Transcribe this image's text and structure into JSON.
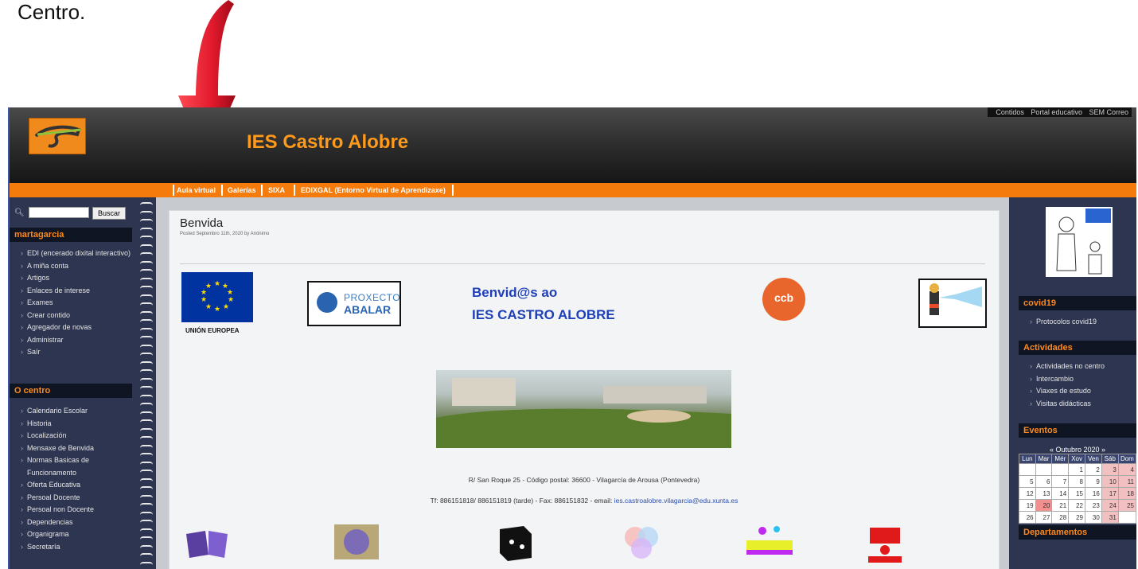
{
  "caption": "Centro.",
  "header": {
    "site_title": "IES Castro Alobre",
    "top_links": [
      "Contidos",
      "Portal educativo",
      "SEM Correo"
    ]
  },
  "nav": [
    "Aula virtual",
    "Galerías",
    "SIXA",
    "EDIXGAL (Entorno Virtual de Aprendizaxe)"
  ],
  "search": {
    "button": "Buscar",
    "value": ""
  },
  "user_block": {
    "title": "martagarcia",
    "items": [
      "EDI (encerado dixital interactivo)",
      "A miña conta",
      "Artigos",
      "Enlaces de interese",
      "Exames",
      "Crear contido",
      "Agregador de novas",
      "Administrar",
      "Saír"
    ]
  },
  "centro_block": {
    "title": "O centro",
    "items": [
      "Calendario Escolar",
      "Historia",
      "Localización",
      "Mensaxe de Benvida",
      "Normas Basicas de Funcionamento",
      "Oferta Educativa",
      "Persoal Docente",
      "Persoal non Docente",
      "Dependencias",
      "Organigrama",
      "Secretaría"
    ]
  },
  "post": {
    "title": "Benvida",
    "meta": "Posted Septembro 11th, 2020 by Anónimo",
    "eu_label": "UNIÓN EUROPEA",
    "abalar_top": "PROXECTO",
    "abalar_bottom": "ABALAR",
    "welcome_line1": "Benvid@s ao",
    "welcome_line2": "IES CASTRO ALOBRE",
    "ccb_text": "ccb",
    "address": "R/ San Roque 25 -   Código postal: 36600 - Vilagarcía de Arousa (Pontevedra)",
    "contact_prefix": "Tf: 886151818/ 886151819 (tarde) - Fax: 886151832 - email: ",
    "contact_email": "ies.castroalobre.vilagarcia@edu.xunta.es"
  },
  "right": {
    "covid_title": "covid19",
    "covid_items": [
      "Protocolos covid19"
    ],
    "actividades_title": "Actividades",
    "actividades_items": [
      "Actividades no centro",
      "Intercambio",
      "Viaxes de estudo",
      "Visitas didácticas"
    ],
    "eventos_title": "Eventos",
    "calendar_title": "« Outubro 2020 »",
    "weekdays": [
      "Lun",
      "Mar",
      "Mér",
      "Xov",
      "Ven",
      "Sáb",
      "Dom"
    ],
    "weeks": [
      [
        "",
        "",
        "",
        "1",
        "2",
        "3",
        "4"
      ],
      [
        "5",
        "6",
        "7",
        "8",
        "9",
        "10",
        "11"
      ],
      [
        "12",
        "13",
        "14",
        "15",
        "16",
        "17",
        "18"
      ],
      [
        "19",
        "20",
        "21",
        "22",
        "23",
        "24",
        "25"
      ],
      [
        "26",
        "27",
        "28",
        "29",
        "30",
        "31",
        ""
      ]
    ],
    "departamentos_title": "Departamentos"
  },
  "colors": {
    "accent": "#f47b0c",
    "panel": "#2d3551",
    "arrow": "#e0192b"
  }
}
